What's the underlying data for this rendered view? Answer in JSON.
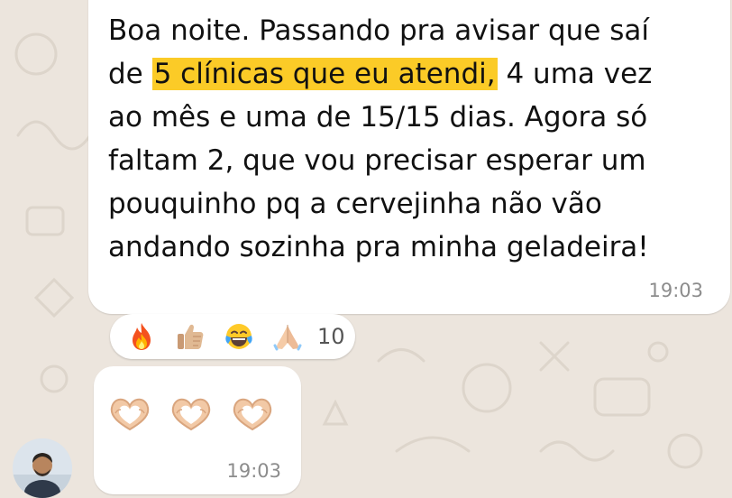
{
  "message_1": {
    "lines": [
      {
        "text": "Boa noite. Passando pra avisar que saí"
      },
      {
        "pre": "de ",
        "highlight": "5 clínicas que eu atendi,",
        "post": " 4 uma vez"
      },
      {
        "text": "ao mês e uma de 15/15 dias. Agora só"
      },
      {
        "text": "faltam 2, que vou precisar esperar um"
      },
      {
        "text": "pouquinho pq a cervejinha não vão"
      },
      {
        "text": "andando sozinha pra minha geladeira!"
      }
    ],
    "time": "19:03"
  },
  "reactions": {
    "icons": [
      "fire-icon",
      "thumbs-up-icon",
      "tears-of-joy-icon",
      "folded-hands-icon"
    ],
    "count": "10"
  },
  "message_2": {
    "emojis": [
      "heart-hands-icon",
      "heart-hands-icon",
      "heart-hands-icon"
    ],
    "time": "19:03"
  },
  "colors": {
    "background": "#ECE5DD",
    "bubble": "#FFFFFF",
    "highlight": "#FBCB27",
    "timestamp": "#8C8C8C"
  }
}
